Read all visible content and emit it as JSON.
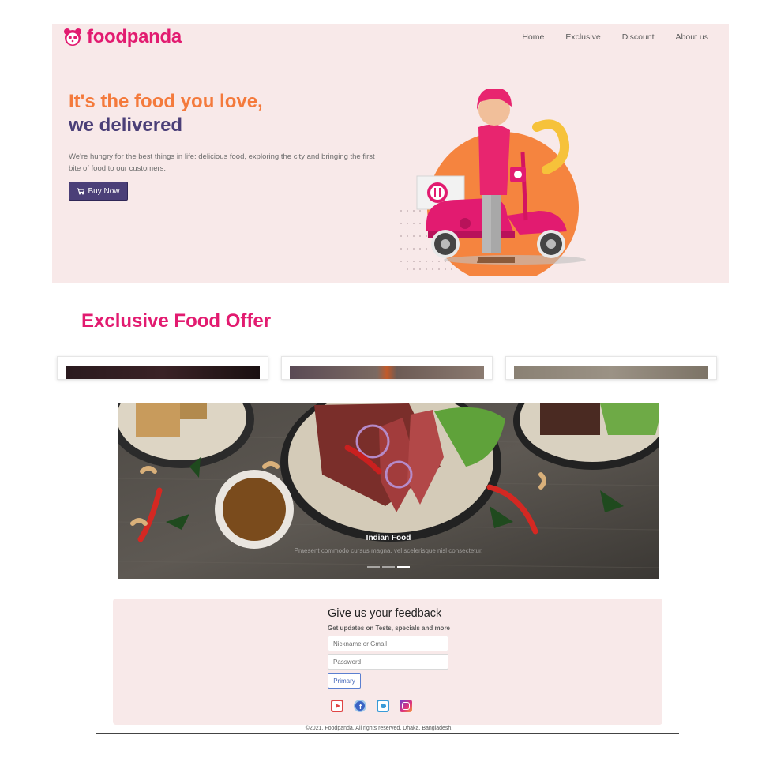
{
  "brand": {
    "name": "foodpanda",
    "icon": "panda-icon",
    "color": "#e21b70"
  },
  "nav": {
    "items": [
      "Home",
      "Exclusive",
      "Discount",
      "About us"
    ]
  },
  "hero": {
    "headline_line1": "It's the food you love,",
    "headline_line2": "we delivered",
    "description": "We're hungry for the best things in life: delicious food, exploring the city and bringing the first bite of food to our customers.",
    "cta_label": "Buy Now",
    "cta_icon": "cart-icon",
    "illustration": "delivery-scooter-illustration"
  },
  "offers": {
    "title": "Exclusive Food Offer",
    "card_count_visible": 3
  },
  "carousel": {
    "caption_title": "Indian Food",
    "caption_text": "Praesent commodo cursus magna, vel scelerisque nisl consectetur.",
    "slides": 3,
    "active_slide": 3
  },
  "feedback": {
    "title": "Give us your feedback",
    "subtitle": "Get updates on Tests, specials and more",
    "name_placeholder": "Nickname or Gmail",
    "password_placeholder": "Password",
    "submit_label": "Primary",
    "socials": [
      "youtube-icon",
      "facebook-icon",
      "twitter-icon",
      "instagram-icon"
    ]
  },
  "footer": {
    "copyright": "©2021, Foodpanda, All rights reserved, Dhaka, Bangladesh."
  },
  "colors": {
    "accent": "#e21b70",
    "orange": "#f47a3c",
    "purple": "#4b3f78",
    "hero_bg": "#f8e9e9"
  }
}
